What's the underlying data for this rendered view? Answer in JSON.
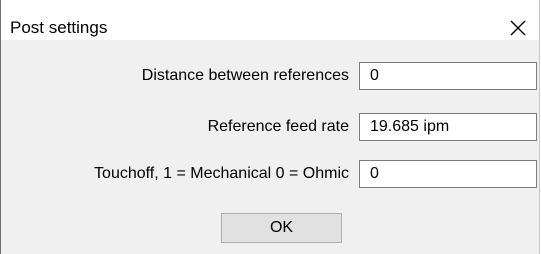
{
  "dialog": {
    "title": "Post settings",
    "close_icon": "close-icon"
  },
  "fields": [
    {
      "label": "Distance between references",
      "value": "0"
    },
    {
      "label": "Reference feed rate",
      "value": "19.685 ipm"
    },
    {
      "label": "Touchoff, 1 = Mechanical 0 = Ohmic",
      "value": "0"
    }
  ],
  "buttons": {
    "ok_label": "OK"
  }
}
